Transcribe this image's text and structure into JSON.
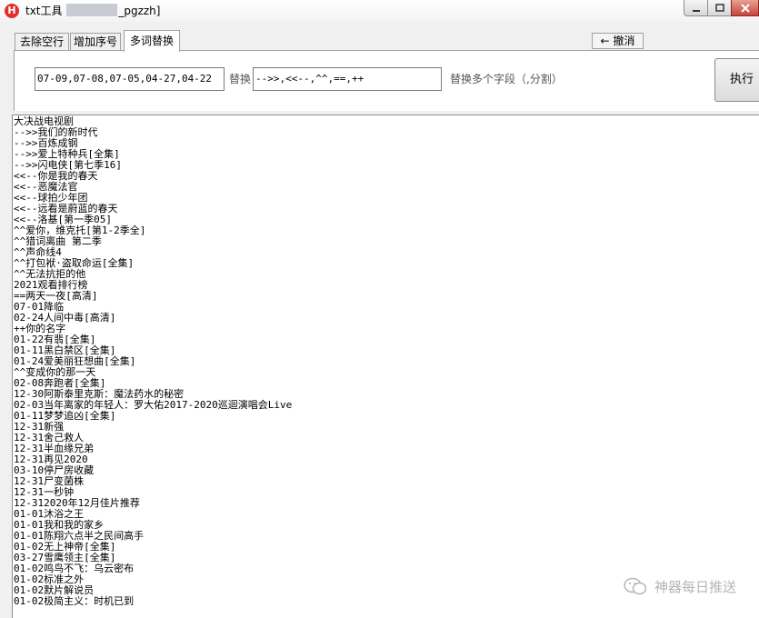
{
  "window": {
    "title_prefix": "txt工具",
    "title_suffix": "_pgzzh]",
    "icon_letter": "H"
  },
  "tabs": [
    {
      "label": "去除空行"
    },
    {
      "label": "增加序号"
    },
    {
      "label": "多词替换",
      "active": true
    }
  ],
  "toolbar": {
    "undo_label": "撤消",
    "undo_icon": "arrow-left-icon"
  },
  "panel": {
    "dates_value": "07-09,07-08,07-05,04-27,04-22",
    "replace_label": "替换",
    "pattern_value": "-->>,<<--,^^,==,++",
    "hint": "替换多个字段（,分割）",
    "execute_label": "执行"
  },
  "output_lines": [
    "大决战电视剧",
    "-->>我们的新时代",
    "-->>百炼成钢",
    "-->>爱上特种兵[全集]",
    "-->>闪电侠[第七季16]",
    "<<--你是我的春天",
    "<<--恶魔法官",
    "<<--球拍少年团",
    "<<--远看是蔚蓝的春天",
    "<<--洛基[第一季05]",
    "^^爱你，维克托[第1-2季全]",
    "^^猎词离曲 第二季",
    "^^声命线4",
    "^^打包袱·盗取命运[全集]",
    "^^无法抗拒的他",
    "2021观看排行榜",
    "==两天一夜[高清]",
    "07-01降临",
    "02-24人间中毒[高清]",
    "++你的名字",
    "01-22有翡[全集]",
    "01-11黑白禁区[全集]",
    "01-24爱美丽狂想曲[全集]",
    "^^变成你的那一天",
    "02-08奔跑者[全集]",
    "12-30阿斯泰里克斯：魔法药水的秘密",
    "02-03当年离家的年轻人：罗大佑2017-2020巡迴演唱会Live",
    "01-11梦梦追凶[全集]",
    "12-31新强",
    "12-31舍己救人",
    "12-31半血缘兄弟",
    "12-31再见2020",
    "03-10停尸房收藏",
    "12-31尸变菌株",
    "12-31一秒钟",
    "12-312020年12月佳片推荐",
    "01-01沐浴之王",
    "01-01我和我的家乡",
    "01-01陈翔六点半之民间高手",
    "01-02无上神帝[全集]",
    "03-27雪鹰领主[全集]",
    "01-02鸣鸟不飞：乌云密布",
    "01-02标准之外",
    "01-02默片解说员",
    "01-02极简主义：时机已到"
  ],
  "watermark": {
    "text": "神器每日推送",
    "icon": "wechat-icon"
  },
  "colors": {
    "app_icon": "#e0302a",
    "close_button": "#c8453a",
    "watermark": "#b5b5b5"
  }
}
